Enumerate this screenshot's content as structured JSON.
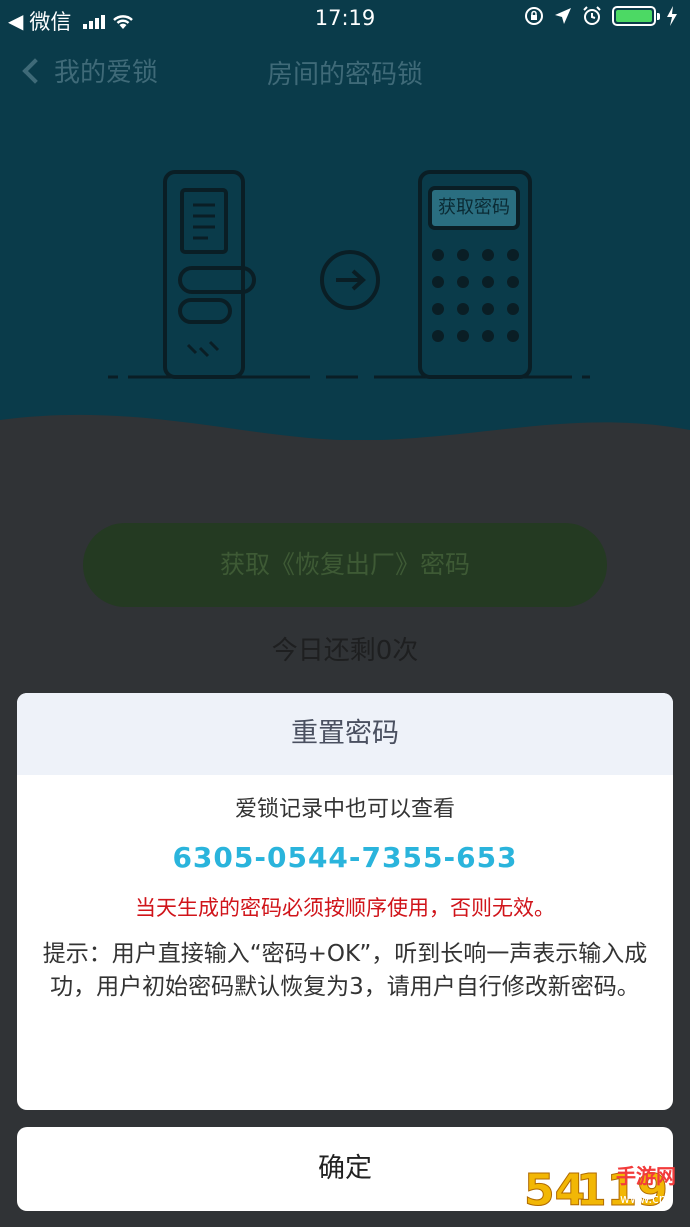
{
  "status_bar": {
    "back_app": "微信",
    "time": "17:19"
  },
  "nav": {
    "back_label": "我的爱锁",
    "title": "房间的密码锁"
  },
  "illustration": {
    "keypad_label": "获取密码"
  },
  "main": {
    "get_button_label": "获取《恢复出厂》密码",
    "remaining_text": "今日还剩0次"
  },
  "dialog": {
    "title": "重置密码",
    "subtitle": "爱锁记录中也可以查看",
    "code": "6305-0544-7355-653",
    "warning": "当天生成的密码必须按顺序使用，否则无效。",
    "tip": "提示：用户直接输入“密码+OK”，听到长响一声表示输入成功，用户初始密码默认恢复为3，请用户自行修改新密码。"
  },
  "confirm_button_label": "确定",
  "watermark": {
    "brand": "54119",
    "name": "手游网",
    "site": "www.cn"
  },
  "colors": {
    "hero_bg": "#0a3b4a",
    "code": "#2ab4dc",
    "warning": "#d0141a",
    "battery": "#4cd964"
  }
}
